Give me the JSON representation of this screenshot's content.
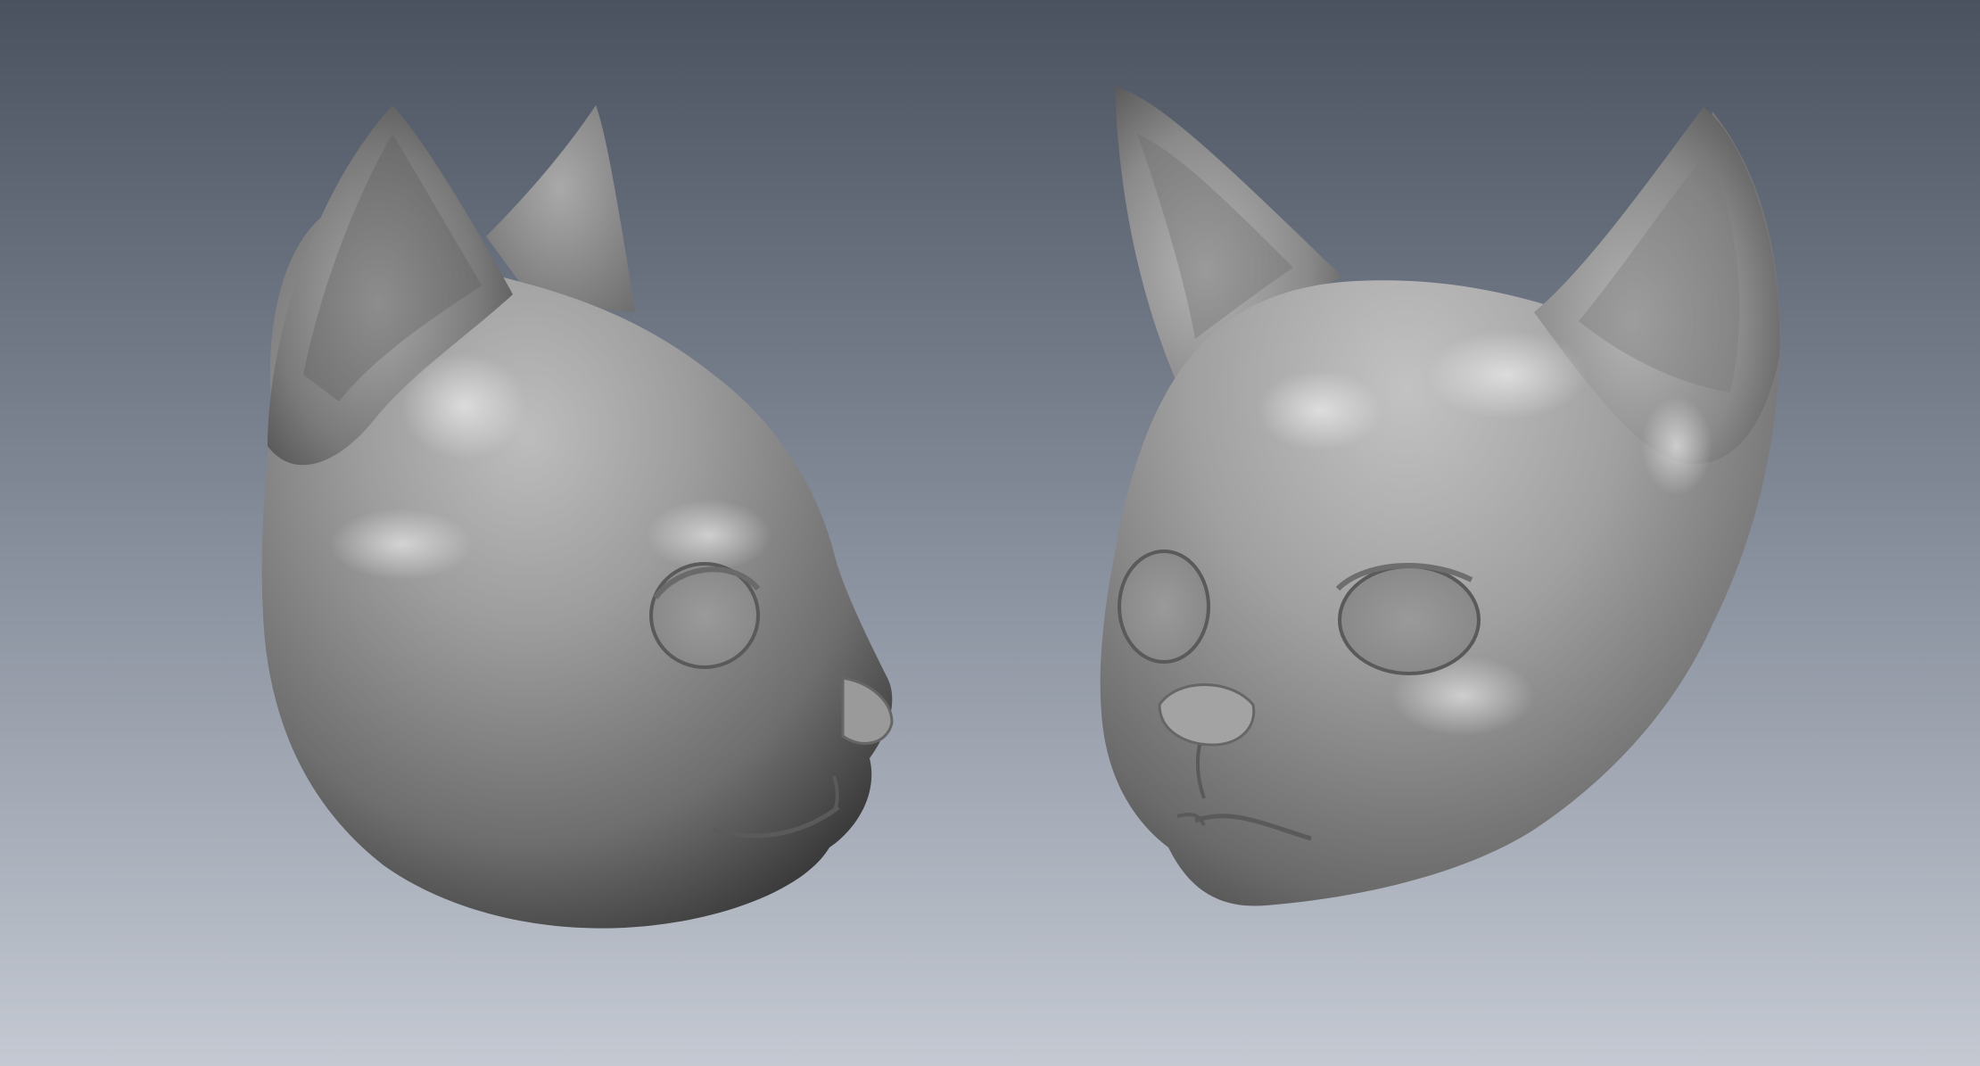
{
  "viewport": {
    "background_top": "#4c5360",
    "background_bottom": "#c2c7d0",
    "model_color": "#8f8f8f"
  },
  "models": [
    {
      "name": "cat-head-side-view"
    },
    {
      "name": "cat-head-three-quarter-view"
    }
  ]
}
